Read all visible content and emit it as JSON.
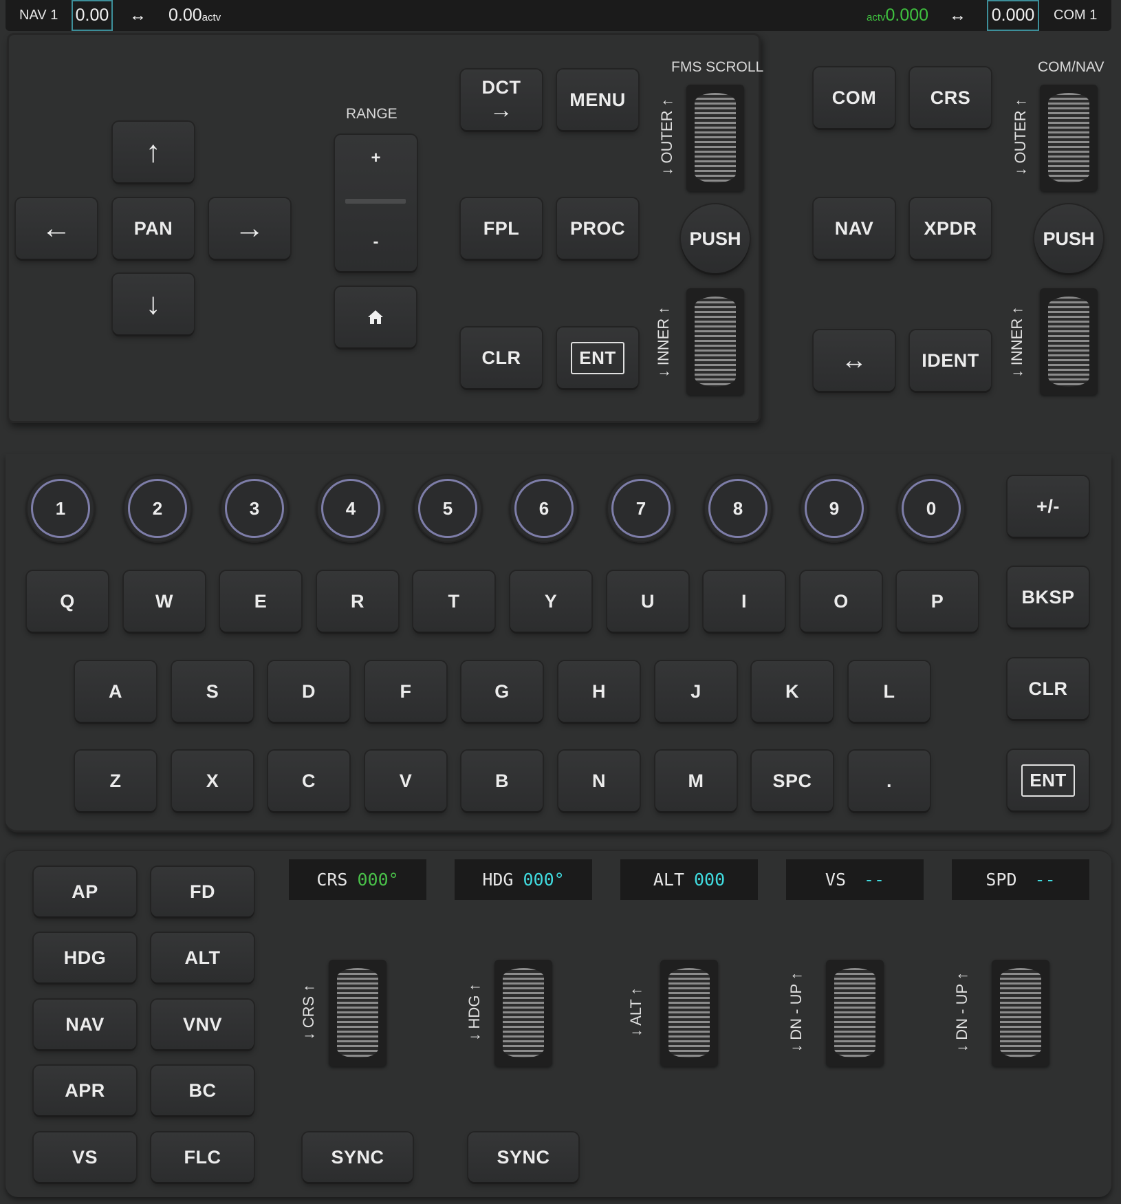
{
  "topbar": {
    "nav_label": "NAV 1",
    "nav_standby": "0.00",
    "nav_swap": "↔",
    "nav_active": "0.00",
    "nav_active_sub": "actv",
    "com_active_sub": "actv",
    "com_active": "0.000",
    "com_swap": "↔",
    "com_standby": "0.000",
    "com_label": "COM 1"
  },
  "fms": {
    "pan": {
      "up": "↑",
      "left": "←",
      "center": "PAN",
      "right": "→",
      "down": "↓"
    },
    "range_label": "RANGE",
    "range_plus": "+",
    "range_minus": "-",
    "home_icon": "home-icon",
    "dct_label": "DCT",
    "dct_arrow": "→",
    "menu": "MENU",
    "fpl": "FPL",
    "proc": "PROC",
    "clr": "CLR",
    "ent": "ENT",
    "scroll_label": "FMS SCROLL",
    "outer": "↓ OUTER ↑",
    "inner": "↓ INNER ↑",
    "push": "PUSH"
  },
  "comnav": {
    "label": "COM/NAV",
    "com": "COM",
    "crs": "CRS",
    "nav": "NAV",
    "xpdr": "XPDR",
    "swap": "↔",
    "ident": "IDENT",
    "outer": "↓ OUTER ↑",
    "inner": "↓ INNER ↑",
    "push": "PUSH"
  },
  "keyboard": {
    "numbers": [
      "1",
      "2",
      "3",
      "4",
      "5",
      "6",
      "7",
      "8",
      "9",
      "0"
    ],
    "plusminus": "+/-",
    "row1": [
      "Q",
      "W",
      "E",
      "R",
      "T",
      "Y",
      "U",
      "I",
      "O",
      "P"
    ],
    "row2": [
      "A",
      "S",
      "D",
      "F",
      "G",
      "H",
      "J",
      "K",
      "L"
    ],
    "row3": [
      "Z",
      "X",
      "C",
      "V",
      "B",
      "N",
      "M",
      "SPC",
      "."
    ],
    "bksp": "BKSP",
    "clr": "CLR",
    "ent": "ENT"
  },
  "autopilot": {
    "buttons": [
      [
        "AP",
        "FD"
      ],
      [
        "HDG",
        "ALT"
      ],
      [
        "NAV",
        "VNV"
      ],
      [
        "APR",
        "BC"
      ],
      [
        "VS",
        "FLC"
      ]
    ],
    "displays": [
      {
        "label": "CRS",
        "value": "000°"
      },
      {
        "label": "HDG",
        "value": "000°"
      },
      {
        "label": "ALT",
        "value": "000"
      },
      {
        "label": "VS",
        "value": "--"
      },
      {
        "label": "SPD",
        "value": "--"
      }
    ],
    "knobs": [
      "↓ CRS ↑",
      "↓ HDG ↑",
      "↓ ALT ↑",
      "↓ DN - UP ↑",
      "↓ DN - UP ↑"
    ],
    "sync": "SYNC",
    "colors": {
      "green": "#49c049",
      "cyan": "#40dce0"
    }
  }
}
